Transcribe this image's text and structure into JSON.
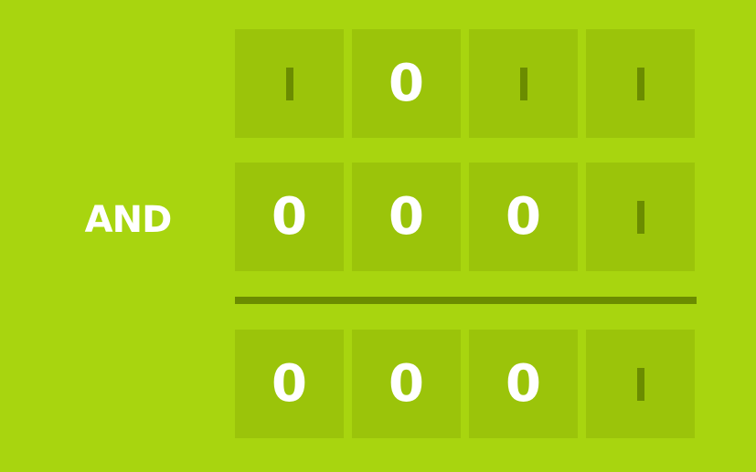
{
  "operator": "AND",
  "rows": [
    {
      "name": "operand-a",
      "bits": [
        "1",
        "0",
        "1",
        "1"
      ]
    },
    {
      "name": "operand-b",
      "bits": [
        "0",
        "0",
        "0",
        "1"
      ]
    },
    {
      "name": "result",
      "bits": [
        "0",
        "0",
        "0",
        "1"
      ]
    }
  ],
  "colors": {
    "background": "#a8d50f",
    "cell": "#9bc40a",
    "one_mark": "#6b8c00",
    "zero_text": "#ffffff",
    "divider": "#6b8c00"
  }
}
